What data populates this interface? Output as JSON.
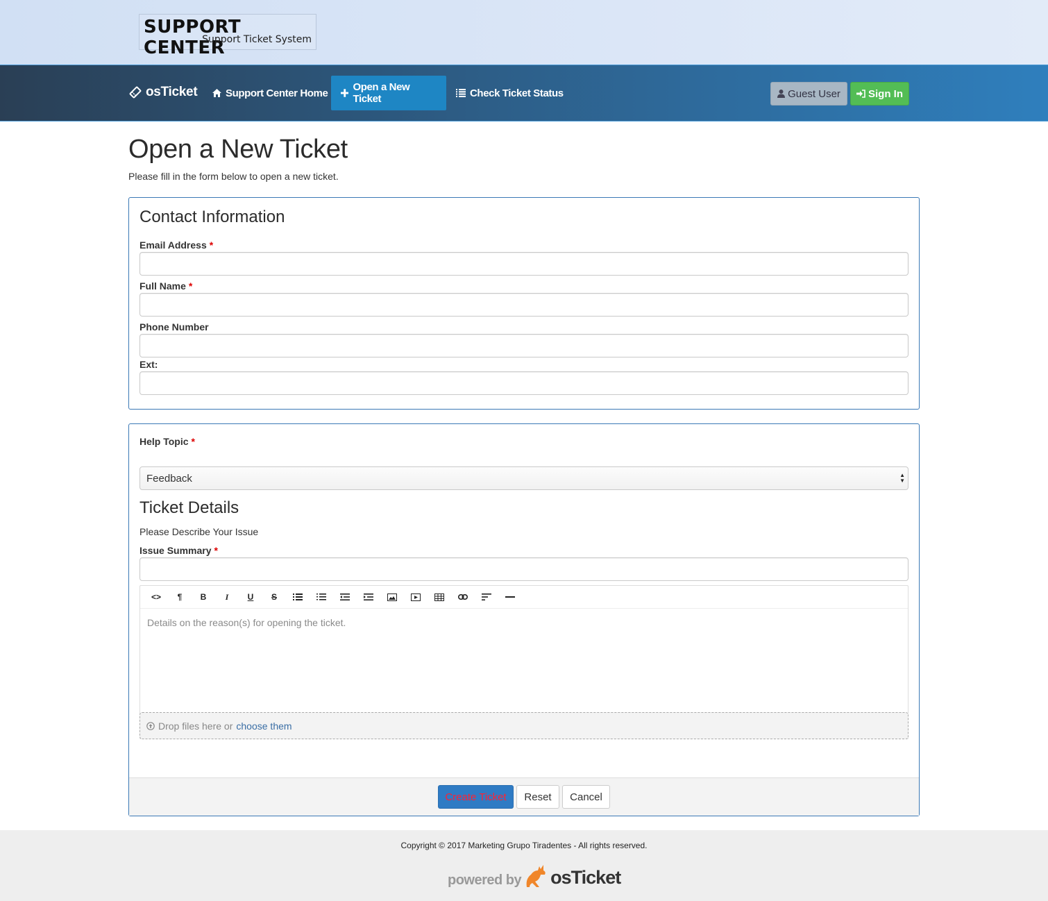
{
  "header": {
    "logo_title": "SUPPORT CENTER",
    "logo_subtitle": "Support Ticket System"
  },
  "nav": {
    "brand": "osTicket",
    "items": [
      {
        "label": "Support Center Home",
        "icon": "home-icon",
        "active": false
      },
      {
        "label": "Open a New Ticket",
        "icon": "plus-icon",
        "active": true
      },
      {
        "label": "Check Ticket Status",
        "icon": "list-icon",
        "active": false
      }
    ],
    "guest_label": "Guest User",
    "signin_label": "Sign In"
  },
  "page": {
    "title": "Open a New Ticket",
    "intro": "Please fill in the form below to open a new ticket."
  },
  "contact": {
    "heading": "Contact Information",
    "email_label": "Email Address",
    "name_label": "Full Name",
    "phone_label": "Phone Number",
    "ext_label": "Ext:",
    "required_mark": "*"
  },
  "ticket": {
    "help_topic_label": "Help Topic",
    "help_topic_value": "Feedback",
    "heading": "Ticket Details",
    "sub": "Please Describe Your Issue",
    "summary_label": "Issue Summary",
    "editor_placeholder": "Details on the reason(s) for opening the ticket.",
    "toolbar": [
      "html",
      "format",
      "bold",
      "italic",
      "underline",
      "strikethrough",
      "unordered-list",
      "ordered-list",
      "outdent",
      "indent",
      "image",
      "video",
      "table",
      "link",
      "alignment",
      "horizontal-rule"
    ],
    "dropzone_text": "Drop files here or",
    "dropzone_link": "choose them"
  },
  "actions": {
    "create": "Create Ticket",
    "reset": "Reset",
    "cancel": "Cancel"
  },
  "footer": {
    "copyright": "Copyright © 2017 Marketing Grupo Tiradentes - All rights reserved.",
    "powered_by": "powered by",
    "powered_logo": "osTicket"
  },
  "colors": {
    "nav_start": "#2a3f55",
    "nav_end": "#2f7fbd",
    "active_tab": "#1e86c4",
    "signin": "#53bd55",
    "guest": "#a8b7c4",
    "panel_border": "#3a78b5",
    "create_button": "#2f7bc4",
    "create_text": "#ff2233"
  }
}
